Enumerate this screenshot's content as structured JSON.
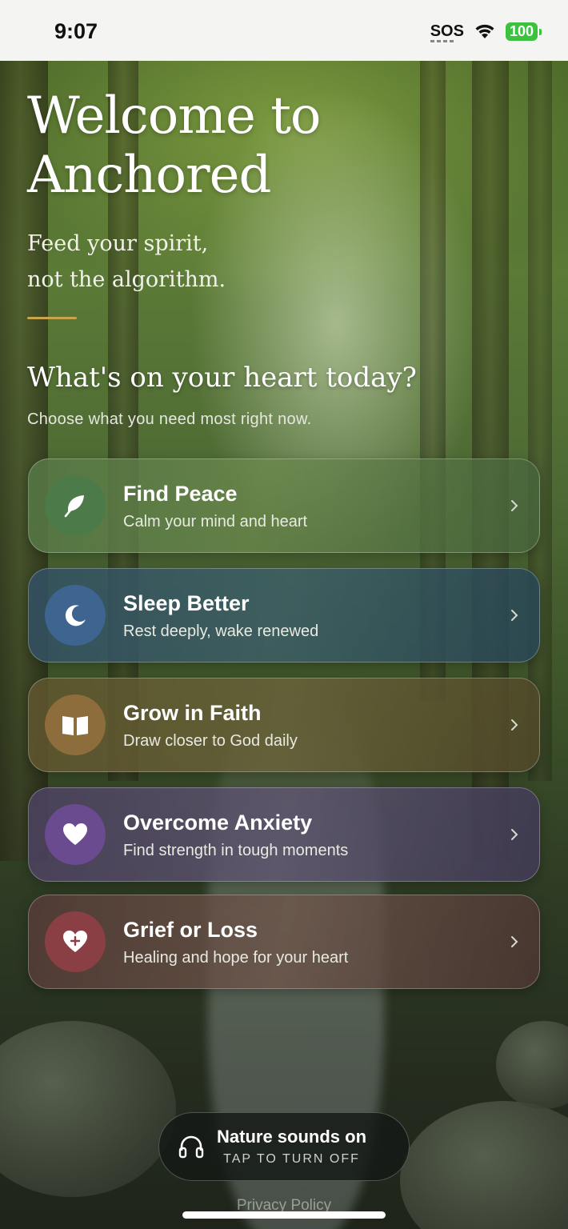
{
  "status_bar": {
    "time": "9:07",
    "sos": "SOS",
    "battery": "100"
  },
  "header": {
    "title": "Welcome to Anchored",
    "tagline_line1": "Feed your spirit,",
    "tagline_line2": "not the algorithm.",
    "question": "What's on your heart today?",
    "subtitle": "Choose what you need most right now."
  },
  "options": [
    {
      "title": "Find Peace",
      "desc": "Calm your mind and heart",
      "icon": "leaf-icon",
      "color": "#4c7a48"
    },
    {
      "title": "Sleep Better",
      "desc": "Rest deeply, wake renewed",
      "icon": "moon-icon",
      "color": "#3d6590"
    },
    {
      "title": "Grow in Faith",
      "desc": "Draw closer to God daily",
      "icon": "book-icon",
      "color": "#8e6d3c"
    },
    {
      "title": "Overcome Anxiety",
      "desc": "Find strength in tough moments",
      "icon": "heart-icon",
      "color": "#6a4b8f"
    },
    {
      "title": "Grief or Loss",
      "desc": "Healing and hope for your heart",
      "icon": "heart-plus-icon",
      "color": "#8a3f44"
    }
  ],
  "sound": {
    "title": "Nature sounds on",
    "subtitle": "TAP TO TURN OFF"
  },
  "footer": {
    "privacy": "Privacy Policy"
  },
  "colors": {
    "accent_gold": "#c9a44a"
  }
}
